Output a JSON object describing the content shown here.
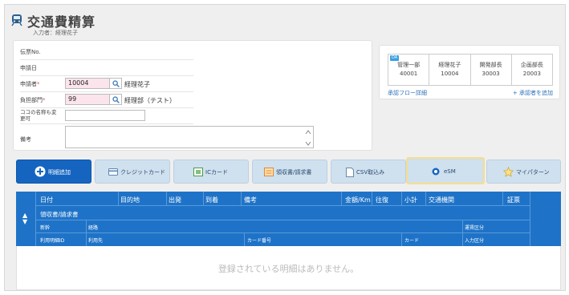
{
  "header": {
    "title": "交通費精算",
    "subtitle": "入力者：経理花子"
  },
  "form": {
    "voucher_label": "伝票No.",
    "apply_date_label": "申請日",
    "applicant_label": "申請者",
    "applicant_code": "10004",
    "applicant_name": "経理花子",
    "dept_label": "負担部門",
    "dept_code": "99",
    "dept_name": "経理部（テスト）",
    "custom_label": "ココの名称も変更可",
    "remarks_label": "備考",
    "required_mark": "*"
  },
  "approval": {
    "badge": "DA",
    "approvers": [
      {
        "role": "管理一部",
        "code": "40001"
      },
      {
        "role": "経理花子",
        "code": "10004"
      },
      {
        "role": "開発部長",
        "code": "30003"
      },
      {
        "role": "企画部長",
        "code": "20003"
      }
    ],
    "flow_link": "承認フロー詳細",
    "add_link": "+ 承認者を追加"
  },
  "toolbar": {
    "add_detail": "明細追加",
    "credit_card": "クレジットカード",
    "ic_card": "ICカード",
    "receipt": "領収書/請求書",
    "csv_import": "CSV取込み",
    "esm": "eSM",
    "my_pattern": "マイパターン"
  },
  "table": {
    "row1": [
      "日付",
      "目的地",
      "出発",
      "到着",
      "備考",
      "金額/Km",
      "往復",
      "小計",
      "交通機関",
      "証票"
    ],
    "row2": [
      "領収書/請求書"
    ],
    "row3": [
      "新幹",
      "経路",
      "運賃区分"
    ],
    "row4": [
      "利用明細ID",
      "利用先",
      "カード番号",
      "カード",
      "入力区分"
    ],
    "empty_message": "登録されている明細はありません。"
  },
  "colors": {
    "accent": "#1e73c8",
    "primary_button": "#1565c0",
    "input_required_bg": "#fce4ec",
    "link": "#2d6fb8"
  }
}
